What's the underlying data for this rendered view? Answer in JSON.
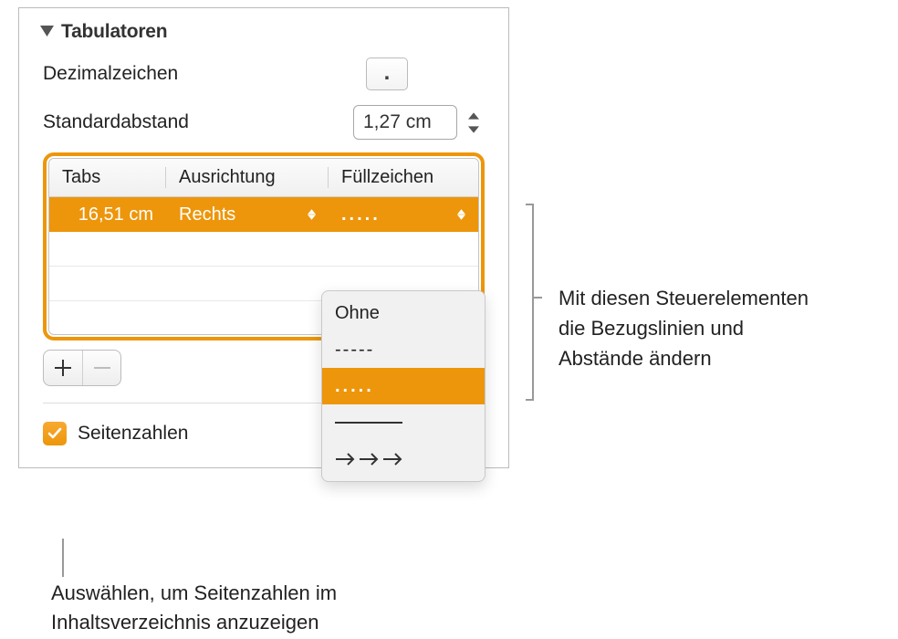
{
  "section": {
    "title": "Tabulatoren"
  },
  "decimal": {
    "label": "Dezimalzeichen",
    "value": "."
  },
  "spacing": {
    "label": "Standardabstand",
    "value": "1,27 cm"
  },
  "table": {
    "headers": {
      "tabs": "Tabs",
      "align": "Ausrichtung",
      "leader": "Füllzeichen"
    },
    "row": {
      "pos": "16,51 cm",
      "align": "Rechts",
      "leader": "....."
    }
  },
  "dropdown": {
    "none": "Ohne",
    "dashes": "-----",
    "dots": ".....",
    "underline": "",
    "arrows": "→→→"
  },
  "pagenum": {
    "label": "Seitenzahlen"
  },
  "callout1": {
    "l1": "Mit diesen Steuerelementen",
    "l2": "die Bezugslinien und",
    "l3": "Abstände ändern"
  },
  "callout2": {
    "l1": "Auswählen, um Seitenzahlen im",
    "l2": "Inhaltsverzeichnis anzuzeigen"
  }
}
